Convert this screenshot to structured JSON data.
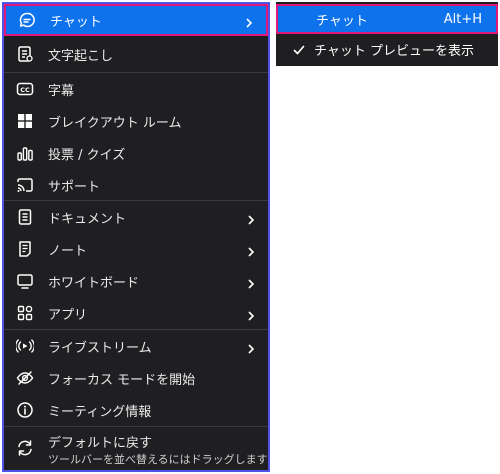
{
  "menu": {
    "items": [
      {
        "label": "チャット",
        "icon": "chat-icon",
        "has_submenu": true
      },
      {
        "label": "文字起こし",
        "icon": "transcript-icon",
        "has_submenu": false
      },
      {
        "label": "字幕",
        "icon": "cc-icon",
        "has_submenu": false
      },
      {
        "label": "ブレイクアウト ルーム",
        "icon": "breakout-rooms-icon",
        "has_submenu": false
      },
      {
        "label": "投票 / クイズ",
        "icon": "poll-icon",
        "has_submenu": false
      },
      {
        "label": "サポート",
        "icon": "support-icon",
        "has_submenu": false
      },
      {
        "label": "ドキュメント",
        "icon": "document-icon",
        "has_submenu": true
      },
      {
        "label": "ノート",
        "icon": "notes-icon",
        "has_submenu": true
      },
      {
        "label": "ホワイトボード",
        "icon": "whiteboard-icon",
        "has_submenu": true
      },
      {
        "label": "アプリ",
        "icon": "apps-icon",
        "has_submenu": true
      },
      {
        "label": "ライブストリーム",
        "icon": "livestream-icon",
        "has_submenu": true
      },
      {
        "label": "フォーカス モードを開始",
        "icon": "focus-mode-icon",
        "has_submenu": false
      },
      {
        "label": "ミーティング情報",
        "icon": "info-icon",
        "has_submenu": false
      },
      {
        "label": "デフォルトに戻す",
        "sublabel": "ツールバーを並べ替えるにはドラッグします",
        "icon": "reset-icon",
        "has_submenu": false
      }
    ]
  },
  "submenu": {
    "items": [
      {
        "label": "チャット",
        "shortcut": "Alt+H"
      },
      {
        "label": "チャット プレビューを表示",
        "checked": true
      }
    ]
  },
  "colors": {
    "menu_bg": "#1f1f22",
    "highlight": "#0e72ed",
    "annotation_border": "#e0187a",
    "menu_border": "#4d53e6"
  }
}
